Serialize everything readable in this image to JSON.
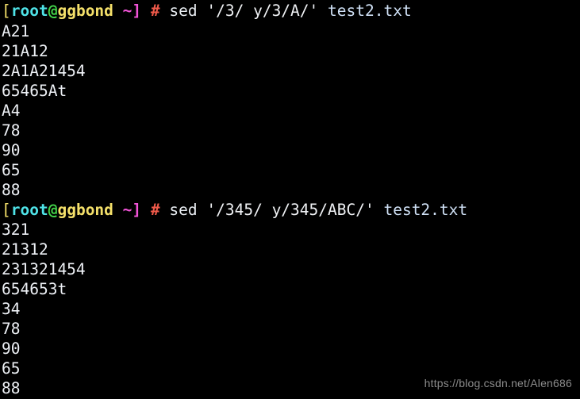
{
  "terminal": {
    "background_color": "#000000",
    "foreground_color": "#eef1f6",
    "prompt": {
      "bracket_open": "[",
      "user": "root",
      "at": "@",
      "host": "ggbond",
      "space_path": " ~",
      "bracket_close": "]",
      "hash": "#",
      "colors": {
        "bracket_open": "#f4e06a",
        "user": "#4fe3e8",
        "at": "#43d44a",
        "host": "#f4e06a",
        "path": "#f254d8",
        "bracket_close": "#f254d8",
        "hash": "#f05a4a"
      }
    },
    "blocks": [
      {
        "command": {
          "name": "sed",
          "script": "'/3/ y/3/A/'",
          "file": "test2.txt"
        },
        "output": [
          "A21",
          "21A12",
          "2A1A21454",
          "65465At",
          "A4",
          "78",
          "90",
          "65",
          "88"
        ]
      },
      {
        "command": {
          "name": "sed",
          "script": "'/345/ y/345/ABC/'",
          "file": "test2.txt"
        },
        "output": [
          "321",
          "21312",
          "231321454",
          "654653t",
          "34",
          "78",
          "90",
          "65",
          "88"
        ]
      }
    ],
    "watermark": "https://blog.csdn.net/Alen686"
  }
}
